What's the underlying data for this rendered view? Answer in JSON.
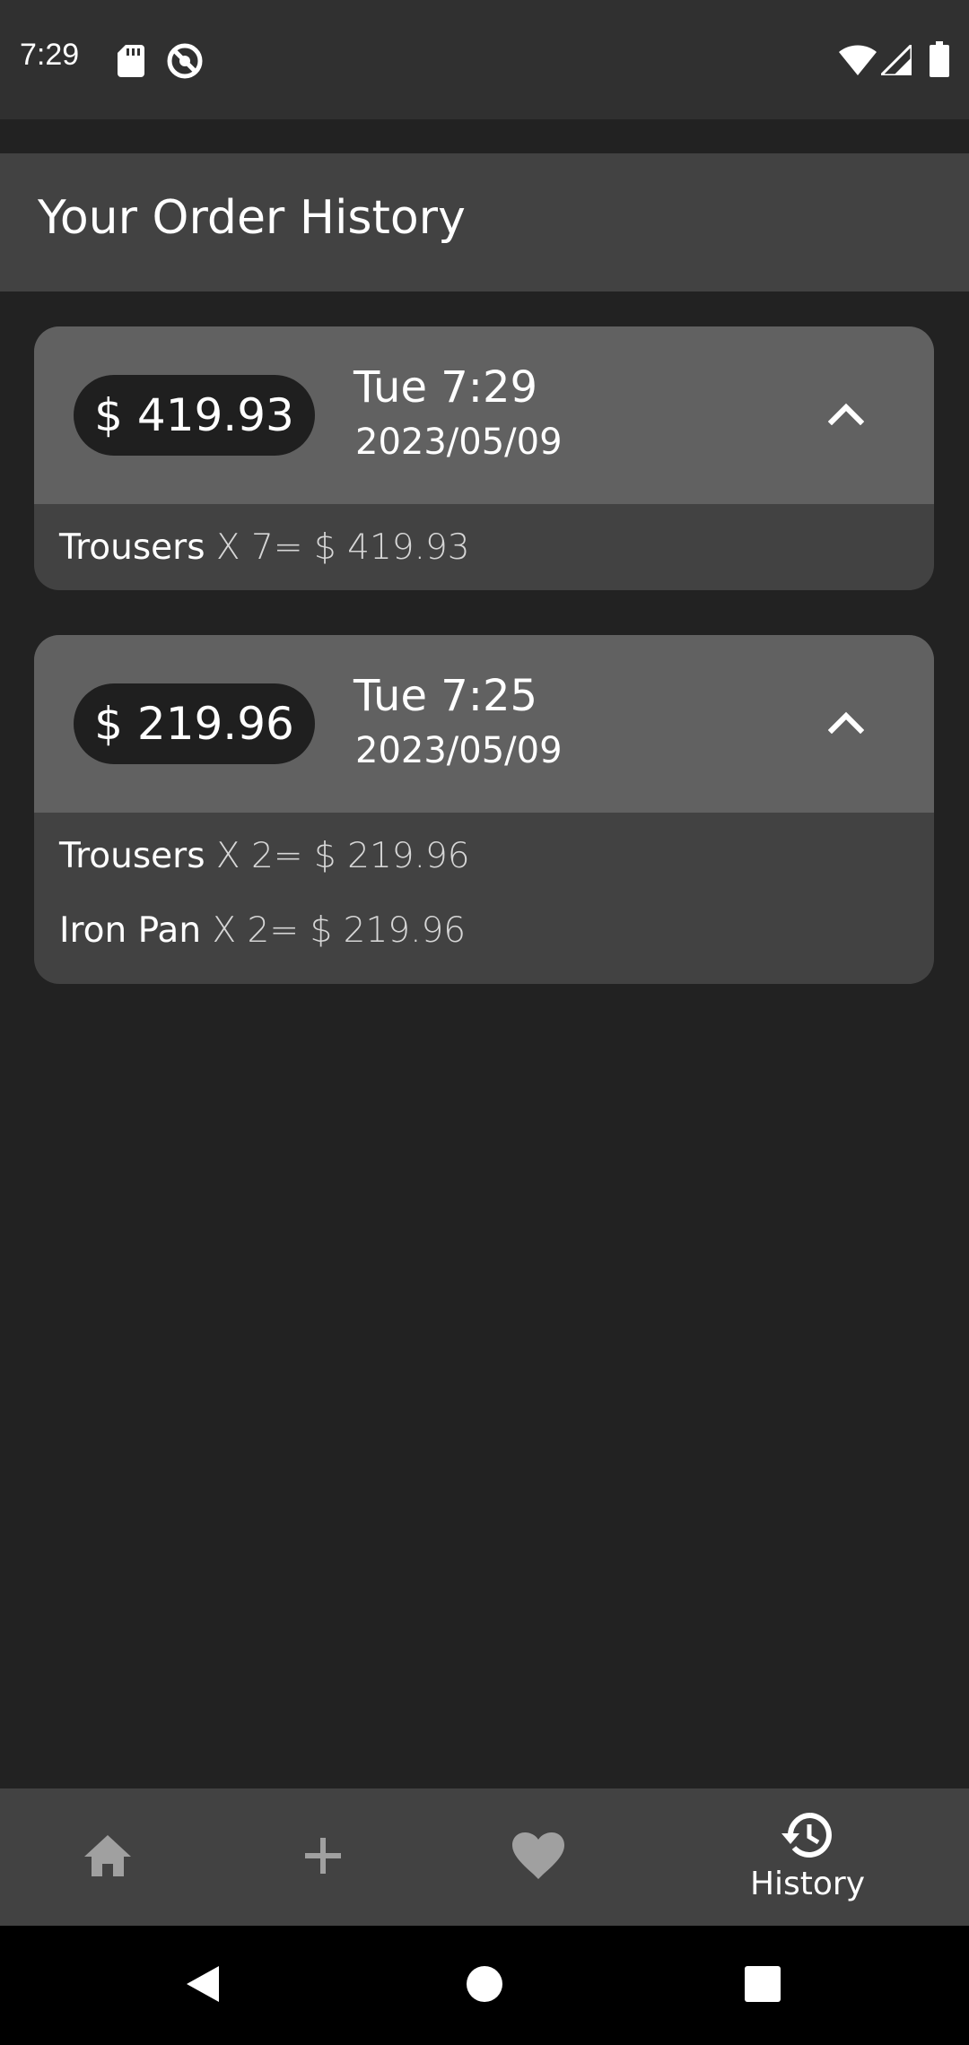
{
  "status_bar": {
    "time": "7:29",
    "icons": [
      "sd-card-icon",
      "do-not-disturb-icon",
      "wifi-icon",
      "cell-signal-icon",
      "battery-icon"
    ]
  },
  "header": {
    "title": "Your Order History"
  },
  "orders": [
    {
      "total": "$ 419.93",
      "time": "Tue 7:29",
      "date": "2023/05/09",
      "expanded": true,
      "items": [
        {
          "name": "Trousers",
          "detail": " X 7= $ 419.93"
        }
      ]
    },
    {
      "total": "$ 219.96",
      "time": "Tue 7:25",
      "date": "2023/05/09",
      "expanded": true,
      "items": [
        {
          "name": "Trousers",
          "detail": " X 2= $ 219.96"
        },
        {
          "name": "Iron Pan",
          "detail": " X 2= $ 219.96"
        }
      ]
    }
  ],
  "bottom_nav": {
    "items": [
      {
        "icon": "home-icon",
        "label": ""
      },
      {
        "icon": "add-icon",
        "label": ""
      },
      {
        "icon": "heart-icon",
        "label": ""
      },
      {
        "icon": "history-icon",
        "label": "History",
        "active": true
      }
    ]
  },
  "colors": {
    "background": "#222222",
    "status_bar": "#303030",
    "app_bar": "#424242",
    "card_header": "#616161",
    "card_body": "#424242",
    "price_pill": "#1f1f1f",
    "nav_inactive_icon": "#a0a0a0",
    "nav_active": "#ffffff"
  }
}
